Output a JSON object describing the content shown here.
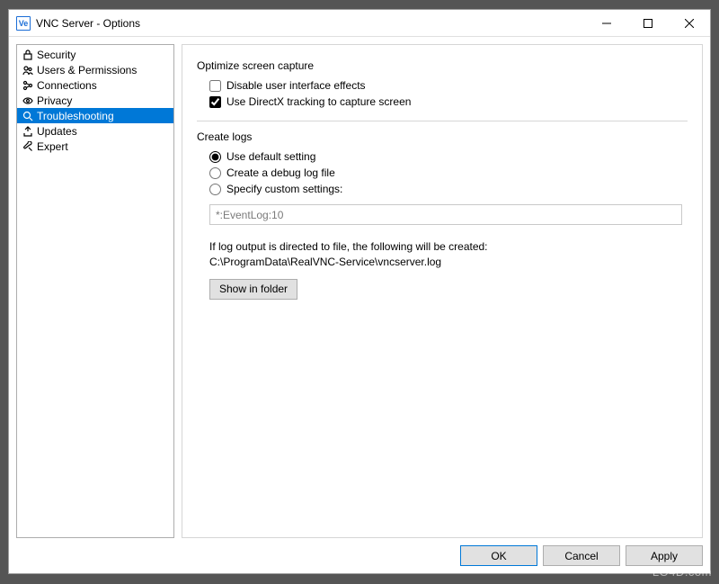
{
  "window": {
    "title": "VNC Server - Options",
    "app_icon_text": "Ve"
  },
  "sidebar": {
    "items": [
      {
        "label": "Security",
        "icon": "lock-icon"
      },
      {
        "label": "Users & Permissions",
        "icon": "users-icon"
      },
      {
        "label": "Connections",
        "icon": "connections-icon"
      },
      {
        "label": "Privacy",
        "icon": "eye-icon"
      },
      {
        "label": "Troubleshooting",
        "icon": "magnifier-icon"
      },
      {
        "label": "Updates",
        "icon": "update-icon"
      },
      {
        "label": "Expert",
        "icon": "wrench-icon"
      }
    ],
    "selected_index": 4
  },
  "content": {
    "optimize": {
      "title": "Optimize screen capture",
      "disable_effects": {
        "label": "Disable user interface effects",
        "checked": false
      },
      "use_directx": {
        "label": "Use DirectX tracking to capture screen",
        "checked": true
      }
    },
    "logs": {
      "title": "Create logs",
      "radios": {
        "default": {
          "label": "Use default setting"
        },
        "debug": {
          "label": "Create a debug log file"
        },
        "custom": {
          "label": "Specify custom settings:"
        },
        "selected": "default"
      },
      "custom_value": "*:EventLog:10",
      "info_line1": "If log output is directed to file, the following will be created:",
      "info_line2": "C:\\ProgramData\\RealVNC-Service\\vncserver.log",
      "show_in_folder": "Show in folder"
    }
  },
  "footer": {
    "ok": "OK",
    "cancel": "Cancel",
    "apply": "Apply"
  },
  "watermark": "LO4D.com"
}
